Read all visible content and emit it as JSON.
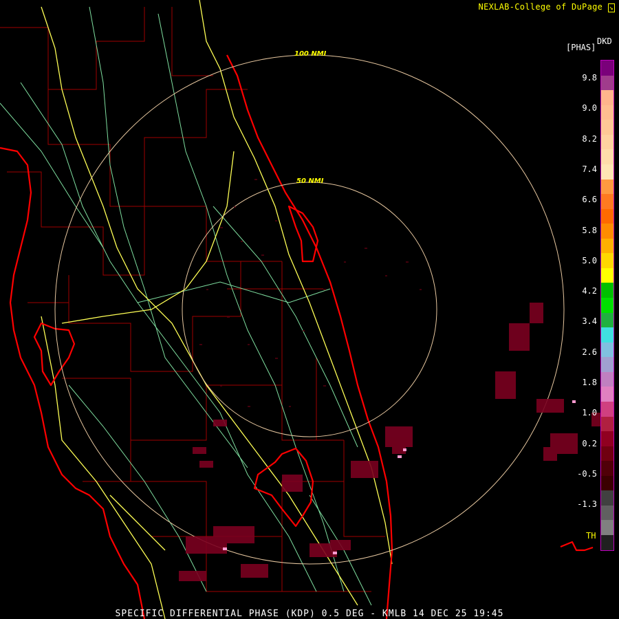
{
  "header": {
    "credit": "NEXLAB-College of DuPage ",
    "credit_icon": "arrow-diagonal-icon"
  },
  "footer": {
    "caption": "SPECIFIC DIFFERENTIAL PHASE (KDP) 0.5 DEG - KMLB 14 DEC 25 19:45"
  },
  "radar": {
    "site": "KMLB",
    "product": "SPECIFIC DIFFERENTIAL PHASE (KDP)",
    "elevation": "0.5 DEG",
    "date": "14 DEC 25",
    "time": "19:45",
    "range_rings": [
      {
        "label": "100 NMI",
        "range_nmi": 100
      },
      {
        "label": "50 NMI",
        "range_nmi": 50
      }
    ]
  },
  "legend": {
    "units": "[PHAS]",
    "product_code": "DKD",
    "threshold_label": "TH",
    "ticks": [
      "9.8",
      "9.0",
      "8.2",
      "7.4",
      "6.6",
      "5.8",
      "5.0",
      "4.2",
      "3.4",
      "2.6",
      "1.8",
      "1.0",
      "0.2",
      "-0.5",
      "-1.3"
    ],
    "colors_top_to_bottom": [
      "#7a007a",
      "#a03c8c",
      "#ffb48c",
      "#ffbe90",
      "#ffc896",
      "#ffd2a0",
      "#ffdcaa",
      "#ffe6b4",
      "#ff9a40",
      "#ff7a20",
      "#ff6a00",
      "#ff8c00",
      "#ffb000",
      "#ffd700",
      "#ffff00",
      "#00c000",
      "#00e000",
      "#20b040",
      "#40e0e0",
      "#80c0e0",
      "#a0a0d0",
      "#c080c0",
      "#e080c0",
      "#d04080",
      "#b02040",
      "#900020",
      "#700010",
      "#500008",
      "#3a0000",
      "#404040",
      "#606060",
      "#808080",
      "#202020"
    ]
  },
  "colors": {
    "coastline": "#ff0000",
    "county_lines": "#b00000",
    "highways_major": "#ffff66",
    "highways_minor": "#80e0a0",
    "range_rings": "#e8c8a0",
    "echo_weak": "#6a0010",
    "echo_moderate": "#a0304a",
    "echo_strong": "#ff9ad0"
  }
}
